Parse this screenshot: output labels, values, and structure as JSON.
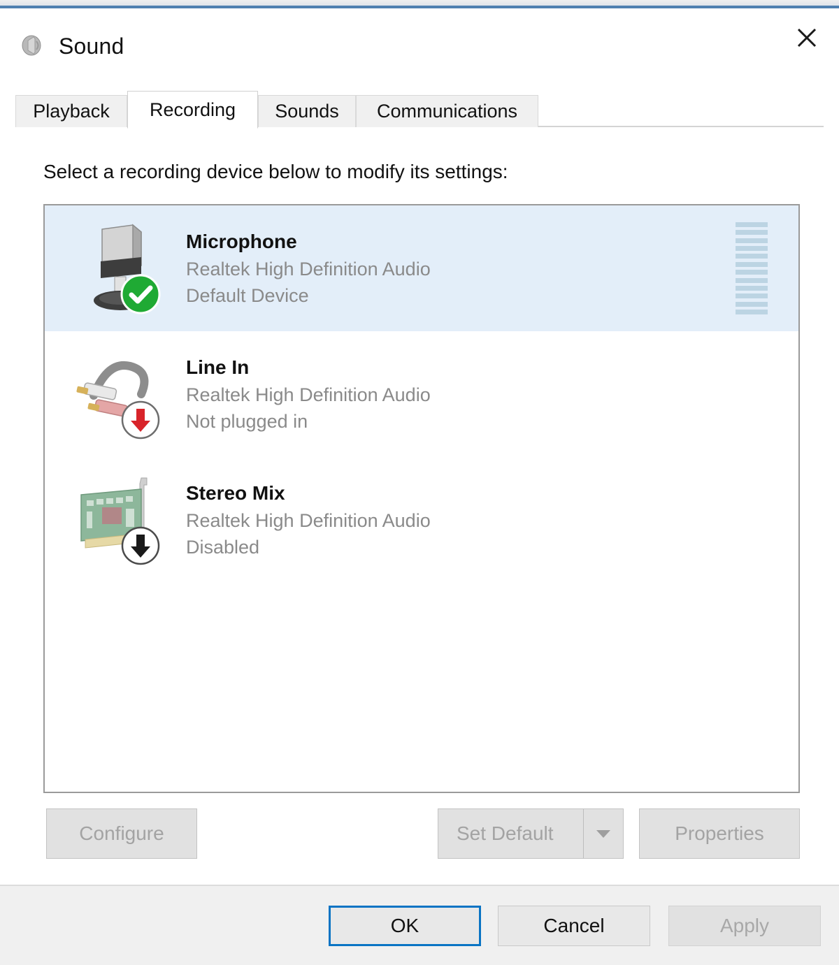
{
  "window": {
    "title": "Sound",
    "icon": "speaker-icon",
    "close_label": "✕",
    "accent_color": "#4f80b0"
  },
  "tabs": [
    {
      "label": "Playback",
      "active": false
    },
    {
      "label": "Recording",
      "active": true
    },
    {
      "label": "Sounds",
      "active": false
    },
    {
      "label": "Communications",
      "active": false
    }
  ],
  "main": {
    "instruction": "Select a recording device below to modify its settings:",
    "devices": [
      {
        "name": "Microphone",
        "driver": "Realtek High Definition Audio",
        "status": "Default Device",
        "icon": "microphone-icon",
        "badge": "green-check-badge",
        "selected": true,
        "meter_segments": 12,
        "meter_color": "#bcd4e3"
      },
      {
        "name": "Line In",
        "driver": "Realtek High Definition Audio",
        "status": "Not plugged in",
        "icon": "rca-cable-icon",
        "badge": "red-down-arrow-badge",
        "selected": false,
        "meter_segments": 0,
        "meter_color": "#bcd4e3"
      },
      {
        "name": "Stereo Mix",
        "driver": "Realtek High Definition Audio",
        "status": "Disabled",
        "icon": "sound-card-icon",
        "badge": "black-down-arrow-badge",
        "selected": false,
        "meter_segments": 0,
        "meter_color": "#bcd4e3"
      }
    ]
  },
  "device_buttons": {
    "configure": "Configure",
    "set_default": "Set Default",
    "set_default_dropdown": "▼",
    "properties": "Properties"
  },
  "footer": {
    "ok": "OK",
    "cancel": "Cancel",
    "apply": "Apply"
  }
}
